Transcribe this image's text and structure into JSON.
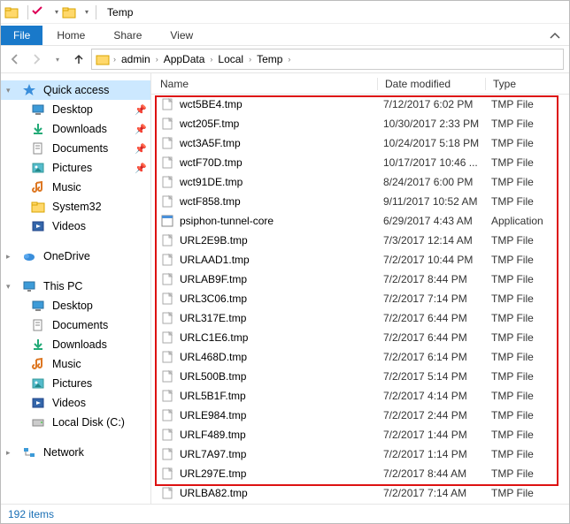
{
  "window": {
    "title": "Temp"
  },
  "ribbon": {
    "file": "File",
    "tabs": [
      "Home",
      "Share",
      "View"
    ]
  },
  "breadcrumb": [
    "admin",
    "AppData",
    "Local",
    "Temp"
  ],
  "status": {
    "count": "192 items"
  },
  "columns": {
    "name": "Name",
    "date": "Date modified",
    "type": "Type"
  },
  "sidebar": {
    "quick": {
      "label": "Quick access",
      "items": [
        {
          "label": "Desktop",
          "pinned": true,
          "icon": "desktop"
        },
        {
          "label": "Downloads",
          "pinned": true,
          "icon": "downloads"
        },
        {
          "label": "Documents",
          "pinned": true,
          "icon": "documents"
        },
        {
          "label": "Pictures",
          "pinned": true,
          "icon": "pictures"
        },
        {
          "label": "Music",
          "pinned": false,
          "icon": "music"
        },
        {
          "label": "System32",
          "pinned": false,
          "icon": "folder"
        },
        {
          "label": "Videos",
          "pinned": false,
          "icon": "videos"
        }
      ]
    },
    "onedrive": {
      "label": "OneDrive"
    },
    "thispc": {
      "label": "This PC",
      "items": [
        {
          "label": "Desktop",
          "icon": "desktop"
        },
        {
          "label": "Documents",
          "icon": "documents"
        },
        {
          "label": "Downloads",
          "icon": "downloads"
        },
        {
          "label": "Music",
          "icon": "music"
        },
        {
          "label": "Pictures",
          "icon": "pictures"
        },
        {
          "label": "Videos",
          "icon": "videos"
        },
        {
          "label": "Local Disk (C:)",
          "icon": "disk"
        }
      ]
    },
    "network": {
      "label": "Network"
    }
  },
  "files": [
    {
      "name": "wct5BE4.tmp",
      "date": "7/12/2017 6:02 PM",
      "type": "TMP File",
      "icon": "file"
    },
    {
      "name": "wct205F.tmp",
      "date": "10/30/2017 2:33 PM",
      "type": "TMP File",
      "icon": "file"
    },
    {
      "name": "wct3A5F.tmp",
      "date": "10/24/2017 5:18 PM",
      "type": "TMP File",
      "icon": "file"
    },
    {
      "name": "wctF70D.tmp",
      "date": "10/17/2017 10:46 ...",
      "type": "TMP File",
      "icon": "file"
    },
    {
      "name": "wct91DE.tmp",
      "date": "8/24/2017 6:00 PM",
      "type": "TMP File",
      "icon": "file"
    },
    {
      "name": "wctF858.tmp",
      "date": "9/11/2017 10:52 AM",
      "type": "TMP File",
      "icon": "file"
    },
    {
      "name": "psiphon-tunnel-core",
      "date": "6/29/2017 4:43 AM",
      "type": "Application",
      "icon": "app"
    },
    {
      "name": "URL2E9B.tmp",
      "date": "7/3/2017 12:14 AM",
      "type": "TMP File",
      "icon": "file"
    },
    {
      "name": "URLAAD1.tmp",
      "date": "7/2/2017 10:44 PM",
      "type": "TMP File",
      "icon": "file"
    },
    {
      "name": "URLAB9F.tmp",
      "date": "7/2/2017 8:44 PM",
      "type": "TMP File",
      "icon": "file"
    },
    {
      "name": "URL3C06.tmp",
      "date": "7/2/2017 7:14 PM",
      "type": "TMP File",
      "icon": "file"
    },
    {
      "name": "URL317E.tmp",
      "date": "7/2/2017 6:44 PM",
      "type": "TMP File",
      "icon": "file"
    },
    {
      "name": "URLC1E6.tmp",
      "date": "7/2/2017 6:44 PM",
      "type": "TMP File",
      "icon": "file"
    },
    {
      "name": "URL468D.tmp",
      "date": "7/2/2017 6:14 PM",
      "type": "TMP File",
      "icon": "file"
    },
    {
      "name": "URL500B.tmp",
      "date": "7/2/2017 5:14 PM",
      "type": "TMP File",
      "icon": "file"
    },
    {
      "name": "URL5B1F.tmp",
      "date": "7/2/2017 4:14 PM",
      "type": "TMP File",
      "icon": "file"
    },
    {
      "name": "URLE984.tmp",
      "date": "7/2/2017 2:44 PM",
      "type": "TMP File",
      "icon": "file"
    },
    {
      "name": "URLF489.tmp",
      "date": "7/2/2017 1:44 PM",
      "type": "TMP File",
      "icon": "file"
    },
    {
      "name": "URL7A97.tmp",
      "date": "7/2/2017 1:14 PM",
      "type": "TMP File",
      "icon": "file"
    },
    {
      "name": "URL297E.tmp",
      "date": "7/2/2017 8:44 AM",
      "type": "TMP File",
      "icon": "file"
    },
    {
      "name": "URLBA82.tmp",
      "date": "7/2/2017 7:14 AM",
      "type": "TMP File",
      "icon": "file"
    }
  ]
}
